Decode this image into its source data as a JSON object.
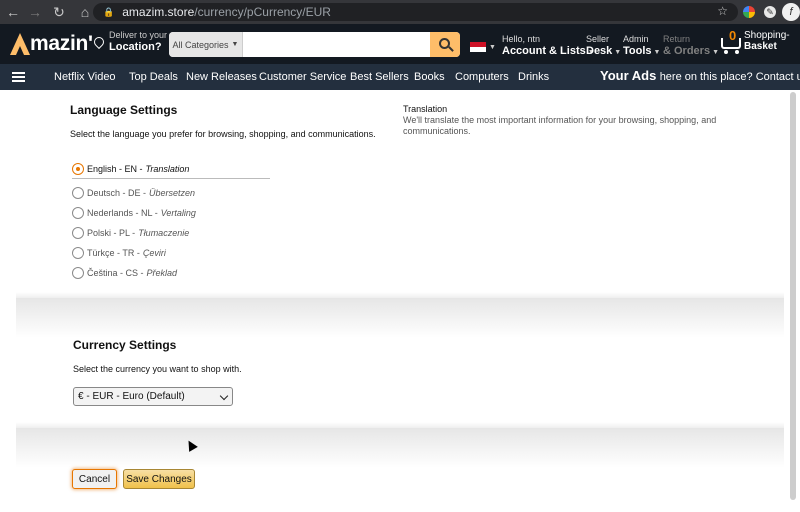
{
  "browser": {
    "url_host": "amazim.store",
    "url_path": "/currency/pCurrency/EUR",
    "profile_initial": "f"
  },
  "header": {
    "logo_text": "mazin'",
    "deliver_line1": "Deliver to your",
    "deliver_line2": "Location?",
    "search_category": "All Categories",
    "search_placeholder": "",
    "account_line1": "Hello, ntn",
    "account_line2": "Account & Lists",
    "seller_line1": "Seller",
    "seller_line2": "Desk",
    "admin_line1": "Admin",
    "admin_line2": "Tools",
    "returns_line1": "Return",
    "returns_line2": "& Orders",
    "cart_count": "0",
    "cart_line1": "Shopping-",
    "cart_line2": "Basket",
    "icons": [
      "location-pin-icon",
      "search-icon",
      "flag-icon",
      "cart-icon"
    ]
  },
  "navbar": {
    "links": [
      "Netflix Video",
      "Top Deals",
      "New Releases",
      "Customer Service",
      "Best Sellers",
      "Books",
      "Computers",
      "Drinks"
    ],
    "ads_big": "Your Ads",
    "ads_small": "here on this place? Contact us"
  },
  "language": {
    "title": "Language Settings",
    "description": "Select the language you prefer for browsing, shopping, and communications.",
    "translation_title": "Translation",
    "translation_desc": "We'll translate the most important information for your browsing, shopping, and communications.",
    "options": [
      {
        "label": "English - EN - ",
        "translation": "Translation",
        "selected": true
      },
      {
        "label": "Deutsch - DE - ",
        "translation": "Übersetzen",
        "selected": false
      },
      {
        "label": "Nederlands - NL - ",
        "translation": "Vertaling",
        "selected": false
      },
      {
        "label": "Polski - PL - ",
        "translation": "Tłumaczenie",
        "selected": false
      },
      {
        "label": "Türkçe - TR - ",
        "translation": "Çeviri",
        "selected": false
      },
      {
        "label": "Čeština - CS - ",
        "translation": "Překlad",
        "selected": false
      }
    ]
  },
  "currency": {
    "title": "Currency Settings",
    "description": "Select the currency you want to shop with.",
    "selected": "€ - EUR - Euro (Default)"
  },
  "actions": {
    "cancel": "Cancel",
    "save": "Save Changes"
  },
  "colors": {
    "header_bg": "#131921",
    "nav_bg": "#232f3e",
    "accent": "#febd69",
    "selected_radio": "#e77600"
  }
}
